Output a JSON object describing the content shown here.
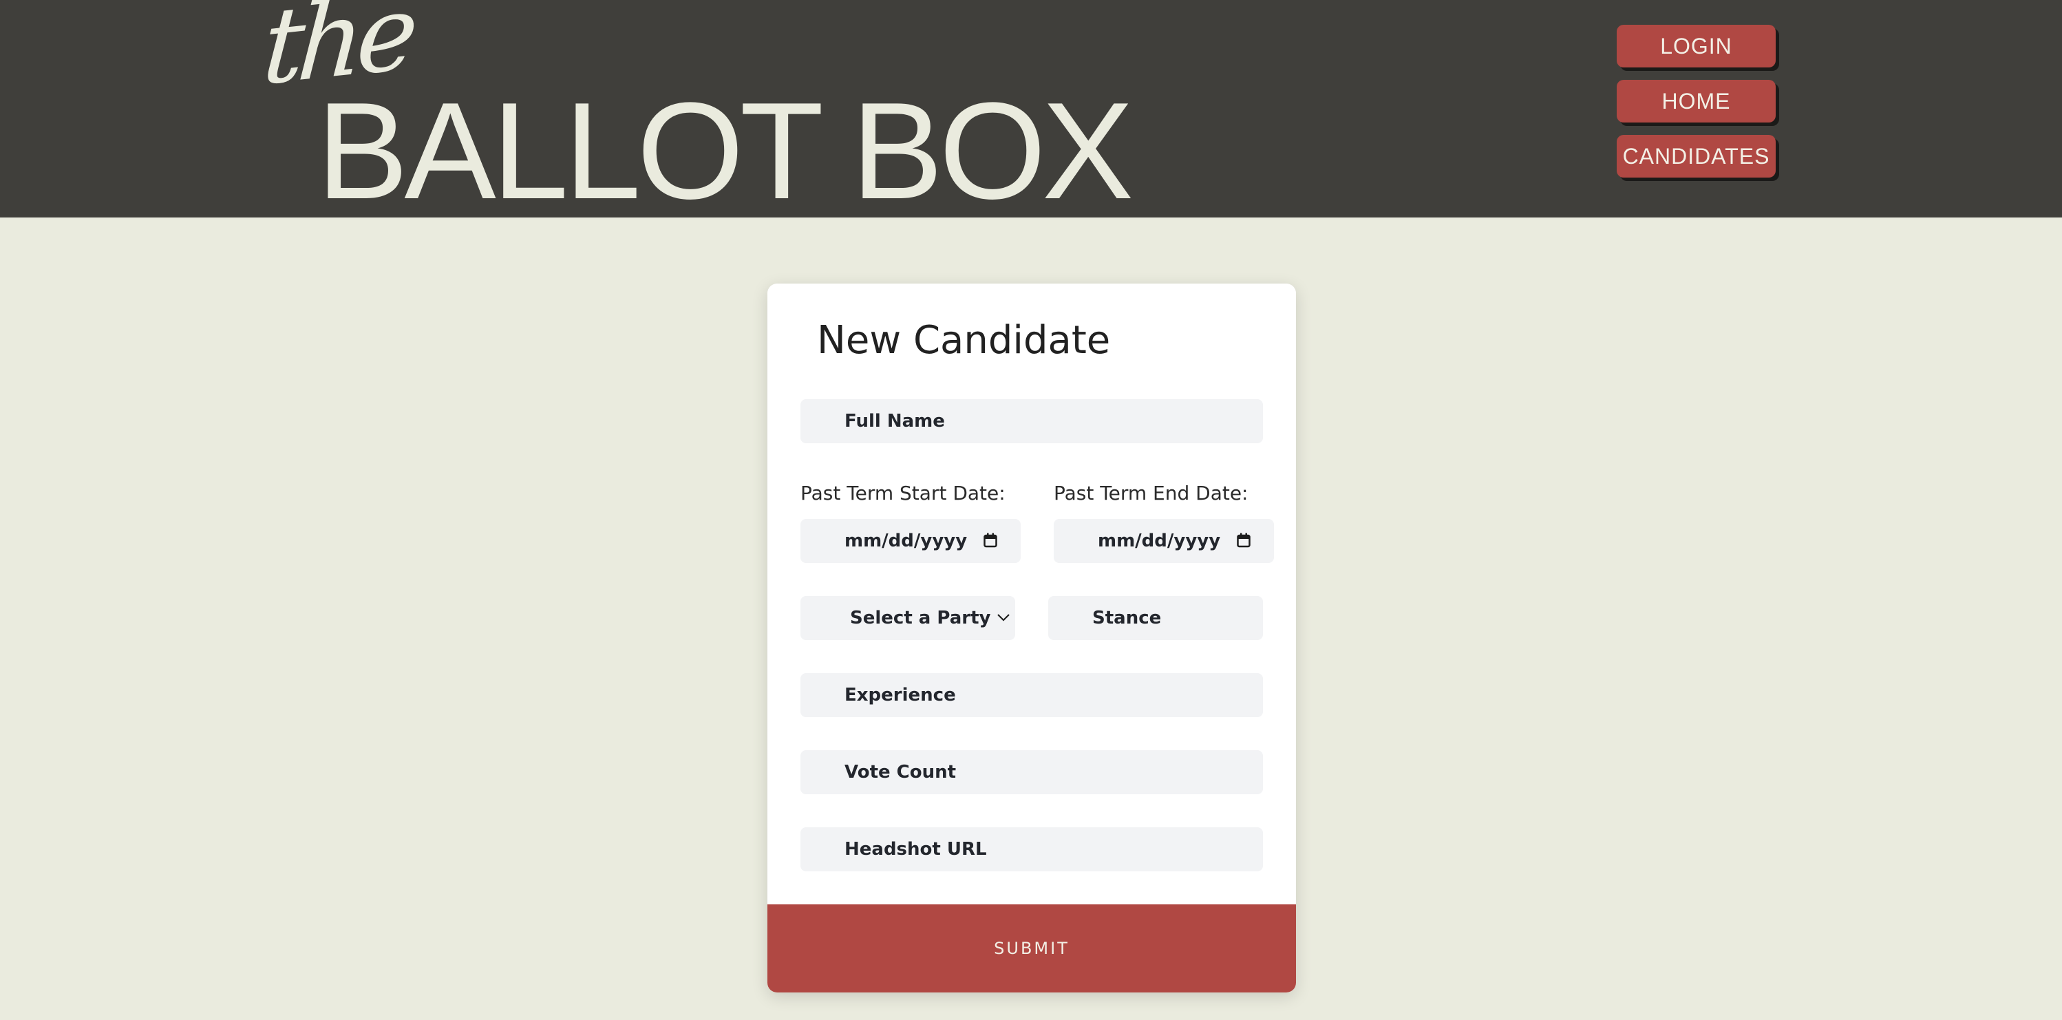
{
  "header": {
    "logo_small": "the",
    "logo_main": "BALLOT BOX",
    "nav": {
      "login": "LOGIN",
      "home": "HOME",
      "candidates": "CANDIDATES"
    }
  },
  "form": {
    "title": "New Candidate",
    "full_name_placeholder": "Full Name",
    "start_date_label": "Past Term Start Date:",
    "end_date_label": "Past Term End Date:",
    "start_date_value": "mm/dd/yyyy",
    "end_date_value": "mm/dd/yyyy",
    "party_select": "Select a Party",
    "stance_placeholder": "Stance",
    "experience_placeholder": "Experience",
    "vote_count_placeholder": "Vote Count",
    "headshot_placeholder": "Headshot URL",
    "submit_label": "SUBMIT"
  },
  "colors": {
    "header_bg": "#403f3b",
    "page_bg": "#eaebde",
    "accent": "#b04843",
    "logo_text": "#eaebde"
  },
  "icons": [
    "calendar-icon",
    "chevron-down-icon"
  ]
}
